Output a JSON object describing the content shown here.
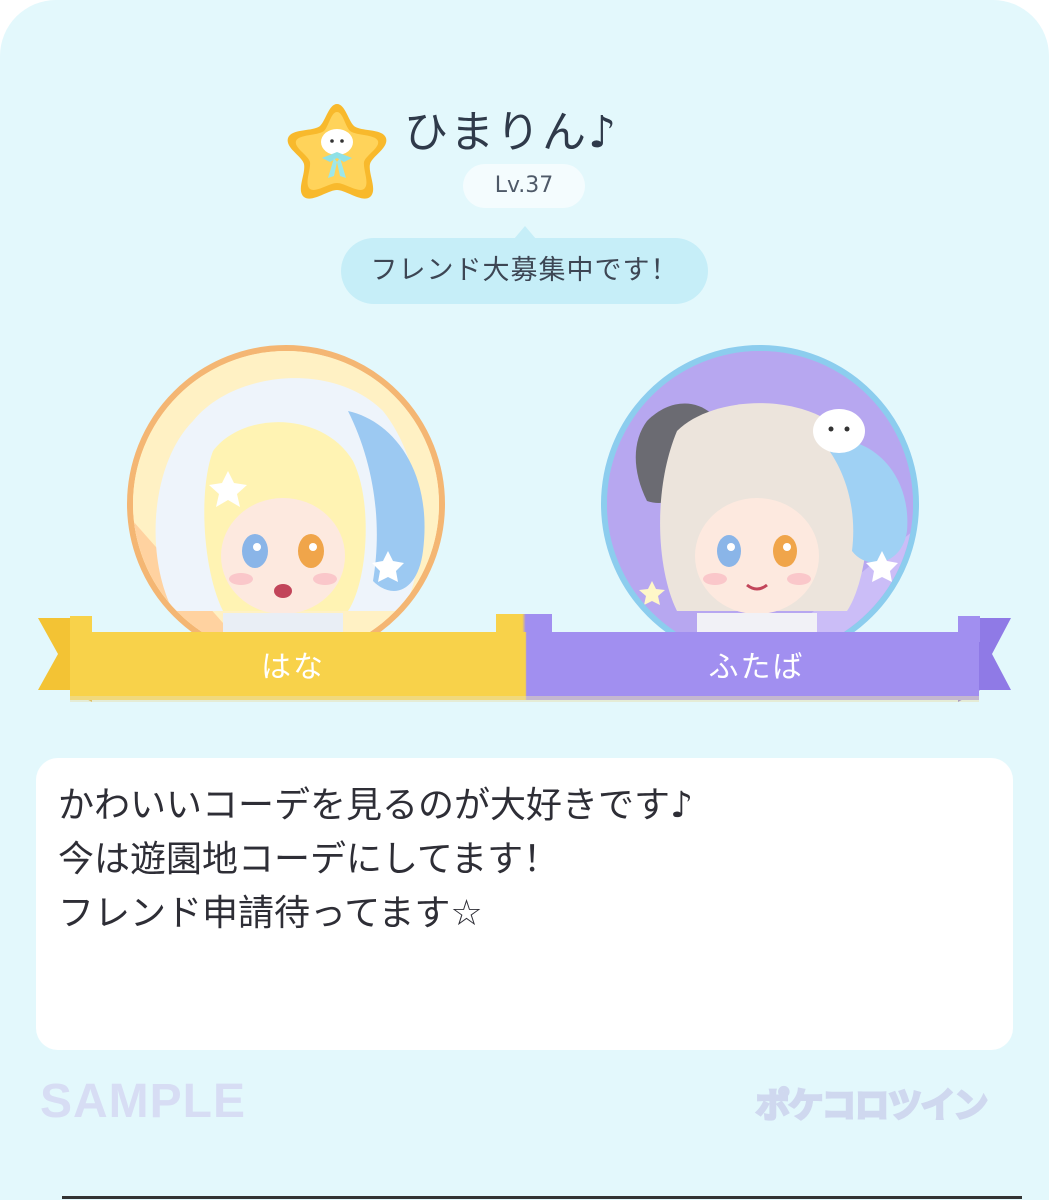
{
  "profile": {
    "name": "ひまりん♪",
    "level": "Lv.37",
    "status": "フレンド大募集中です！"
  },
  "characters": [
    {
      "name": "はな",
      "ribbon_color": "#f8d24a"
    },
    {
      "name": "ふたば",
      "ribbon_color": "#a18ff0"
    }
  ],
  "message": {
    "lines": [
      "かわいいコーデを見るのが大好きです♪",
      "今は遊園地コーデにしてます！",
      "フレンド申請待ってます☆"
    ]
  },
  "footer": {
    "sample": "SAMPLE",
    "logo": "ポケコロツイン"
  },
  "colors": {
    "background": "#e3f8fc",
    "bubble": "#c6eef8",
    "left_ring": "#f4b673",
    "right_ring": "#8ccdee"
  },
  "icons": {
    "badge": "star-badge-icon"
  }
}
